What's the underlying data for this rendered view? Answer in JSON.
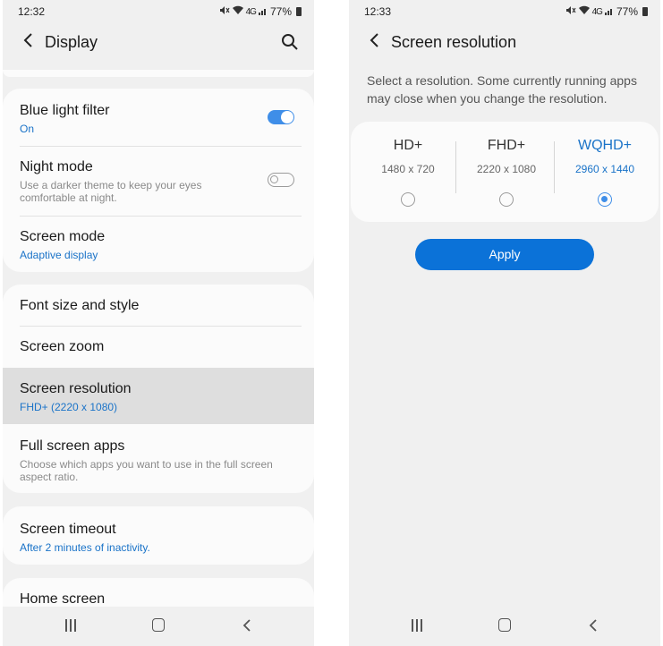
{
  "left": {
    "status": {
      "time": "12:32",
      "battery": "77%",
      "network": "4G"
    },
    "appbar": {
      "title": "Display"
    },
    "items": [
      {
        "title": "Blue light filter",
        "sub": "On"
      },
      {
        "title": "Night mode",
        "sub": "Use a darker theme to keep your eyes comfortable at night."
      },
      {
        "title": "Screen mode",
        "sub": "Adaptive display"
      },
      {
        "title": "Font size and style"
      },
      {
        "title": "Screen zoom"
      },
      {
        "title": "Screen resolution",
        "sub": "FHD+ (2220 x 1080)"
      },
      {
        "title": "Full screen apps",
        "sub": "Choose which apps you want to use in the full screen aspect ratio."
      },
      {
        "title": "Screen timeout",
        "sub": "After 2 minutes of inactivity."
      },
      {
        "title": "Home screen"
      }
    ],
    "toggles": {
      "blue_light_filter": true,
      "night_mode": false
    }
  },
  "right": {
    "status": {
      "time": "12:33",
      "battery": "77%",
      "network": "4G"
    },
    "appbar": {
      "title": "Screen resolution"
    },
    "description": "Select a resolution. Some currently running apps may close when you change the resolution.",
    "options": [
      {
        "name": "HD+",
        "size": "1480 x 720",
        "selected": false
      },
      {
        "name": "FHD+",
        "size": "2220 x 1080",
        "selected": false
      },
      {
        "name": "WQHD+",
        "size": "2960 x 1440",
        "selected": true
      }
    ],
    "apply_label": "Apply"
  },
  "colors": {
    "accent": "#3f8ee8",
    "button": "#0b72d8",
    "background": "#f0f0f0",
    "card": "#fbfbfb"
  },
  "icons": [
    "back-icon",
    "search-icon",
    "wifi-icon",
    "mute-icon",
    "signal-icon",
    "battery-icon",
    "recent-apps-icon",
    "home-icon",
    "nav-back-icon"
  ]
}
